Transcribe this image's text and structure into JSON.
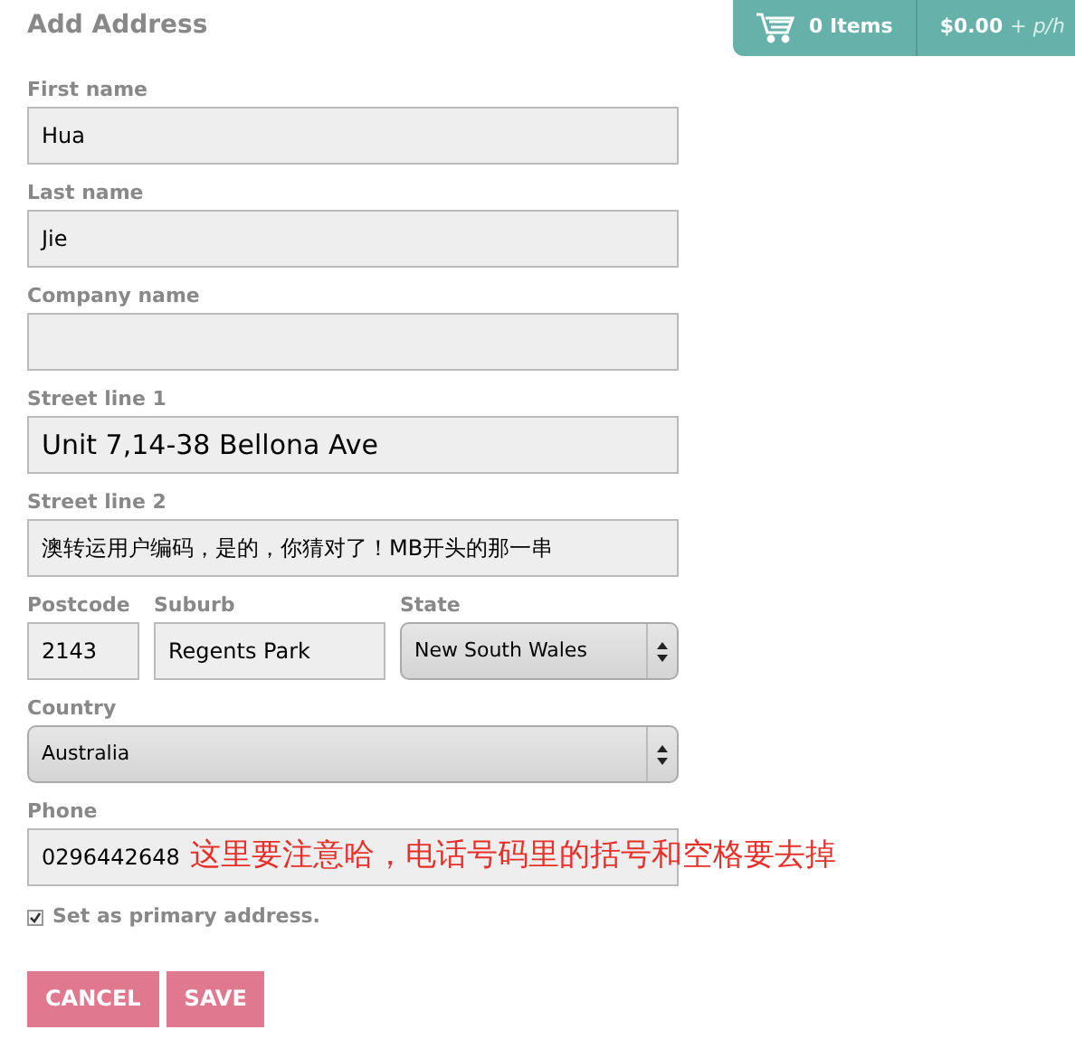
{
  "title": "Add Address",
  "cart": {
    "items": "0 Items",
    "price": "$0.00",
    "suffix": "+ p/h"
  },
  "rows": [
    {
      "fields": [
        {
          "kind": "text",
          "label": "First name",
          "value": "Hua"
        }
      ]
    },
    {
      "fields": [
        {
          "kind": "text",
          "label": "Last name",
          "value": "Jie"
        }
      ]
    },
    {
      "fields": [
        {
          "kind": "text",
          "label": "Company name"
        }
      ]
    },
    {
      "fields": [
        {
          "kind": "text",
          "label": "Street line 1",
          "value": "Unit 7,14-38 Bellona Ave"
        }
      ]
    },
    {
      "fields": [
        {
          "kind": "text",
          "label": "Street line 2",
          "value": "澳转运用户编码，是的，你猜对了！MB开头的那一串"
        }
      ]
    },
    {
      "fields": [
        {
          "kind": "text",
          "label": "Postcode",
          "value": "2143"
        },
        {
          "kind": "text",
          "label": "Suburb",
          "value": "Regents Park"
        },
        {
          "kind": "select",
          "label": "State",
          "value": "New South Wales"
        }
      ]
    },
    {
      "fields": [
        {
          "kind": "select",
          "label": "Country",
          "value": "Australia"
        }
      ]
    },
    {
      "fields": [
        {
          "kind": "text",
          "label": "Phone",
          "value": "0296442648",
          "annotation": "这里要注意哈，电话号码里的括号和空格要去掉"
        }
      ]
    }
  ],
  "primary": {
    "label": "Set as primary address.",
    "checked": true
  },
  "buttons": [
    "CANCEL",
    "SAVE"
  ]
}
